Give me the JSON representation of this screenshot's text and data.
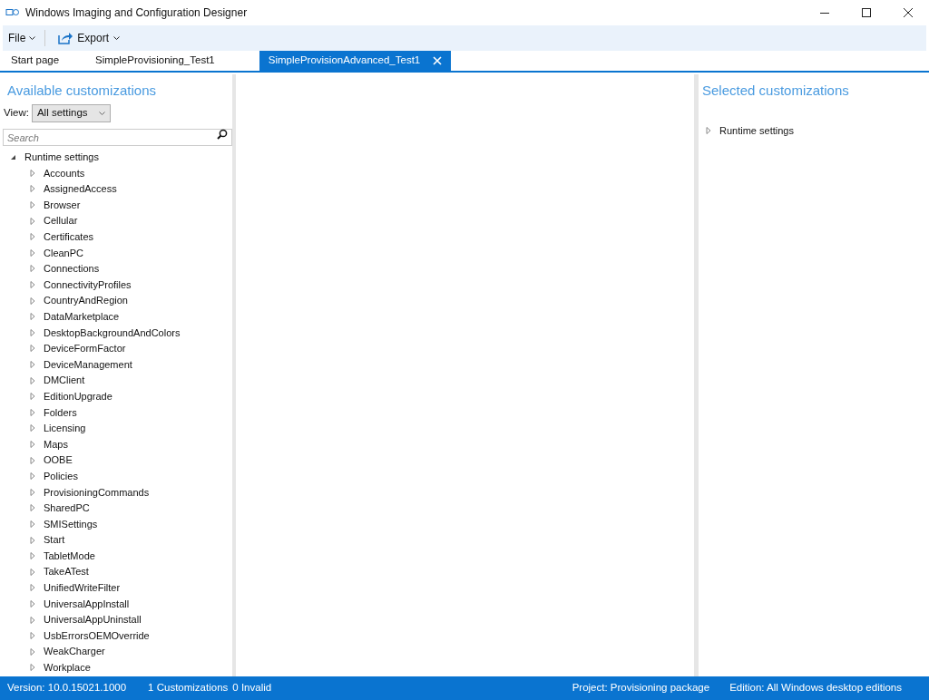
{
  "window": {
    "title": "Windows Imaging and Configuration Designer"
  },
  "toolbar": [
    {
      "label": "File",
      "kind": "menu"
    },
    {
      "label": "Export",
      "kind": "export"
    }
  ],
  "tabs": [
    {
      "label": "Start page",
      "selected": false,
      "closable": false
    },
    {
      "label": "SimpleProvisioning_Test1",
      "selected": false,
      "closable": false
    },
    {
      "label": "SimpleProvisionAdvanced_Test1",
      "selected": true,
      "closable": true
    }
  ],
  "available": {
    "title": "Available customizations",
    "view_label": "View:",
    "view_value": "All settings",
    "search_placeholder": "Search",
    "tree": [
      {
        "label": "Runtime settings",
        "expanded": true,
        "children": [
          {
            "label": "Accounts",
            "expanded": false
          },
          {
            "label": "AssignedAccess",
            "expanded": false
          },
          {
            "label": "Browser",
            "expanded": false
          },
          {
            "label": "Cellular",
            "expanded": false
          },
          {
            "label": "Certificates",
            "expanded": false
          },
          {
            "label": "CleanPC",
            "expanded": false
          },
          {
            "label": "Connections",
            "expanded": false
          },
          {
            "label": "ConnectivityProfiles",
            "expanded": false
          },
          {
            "label": "CountryAndRegion",
            "expanded": false
          },
          {
            "label": "DataMarketplace",
            "expanded": false
          },
          {
            "label": "DesktopBackgroundAndColors",
            "expanded": false
          },
          {
            "label": "DeviceFormFactor",
            "expanded": false
          },
          {
            "label": "DeviceManagement",
            "expanded": false
          },
          {
            "label": "DMClient",
            "expanded": false
          },
          {
            "label": "EditionUpgrade",
            "expanded": false
          },
          {
            "label": "Folders",
            "expanded": false
          },
          {
            "label": "Licensing",
            "expanded": false
          },
          {
            "label": "Maps",
            "expanded": false
          },
          {
            "label": "OOBE",
            "expanded": false
          },
          {
            "label": "Policies",
            "expanded": false
          },
          {
            "label": "ProvisioningCommands",
            "expanded": false
          },
          {
            "label": "SharedPC",
            "expanded": false
          },
          {
            "label": "SMISettings",
            "expanded": false
          },
          {
            "label": "Start",
            "expanded": false
          },
          {
            "label": "TabletMode",
            "expanded": false
          },
          {
            "label": "TakeATest",
            "expanded": false
          },
          {
            "label": "UnifiedWriteFilter",
            "expanded": false
          },
          {
            "label": "UniversalAppInstall",
            "expanded": false
          },
          {
            "label": "UniversalAppUninstall",
            "expanded": false
          },
          {
            "label": "UsbErrorsOEMOverride",
            "expanded": false
          },
          {
            "label": "WeakCharger",
            "expanded": false
          },
          {
            "label": "Workplace",
            "expanded": false
          }
        ]
      }
    ]
  },
  "selected": {
    "title": "Selected customizations",
    "tree": [
      {
        "label": "Runtime settings",
        "expanded": false
      }
    ]
  },
  "status_bar": {
    "left": [
      "Version: 10.0.15021.1000",
      "1 Customizations",
      "0 Invalid"
    ],
    "right": [
      "Project: Provisioning package",
      "Edition: All Windows desktop editions"
    ]
  }
}
